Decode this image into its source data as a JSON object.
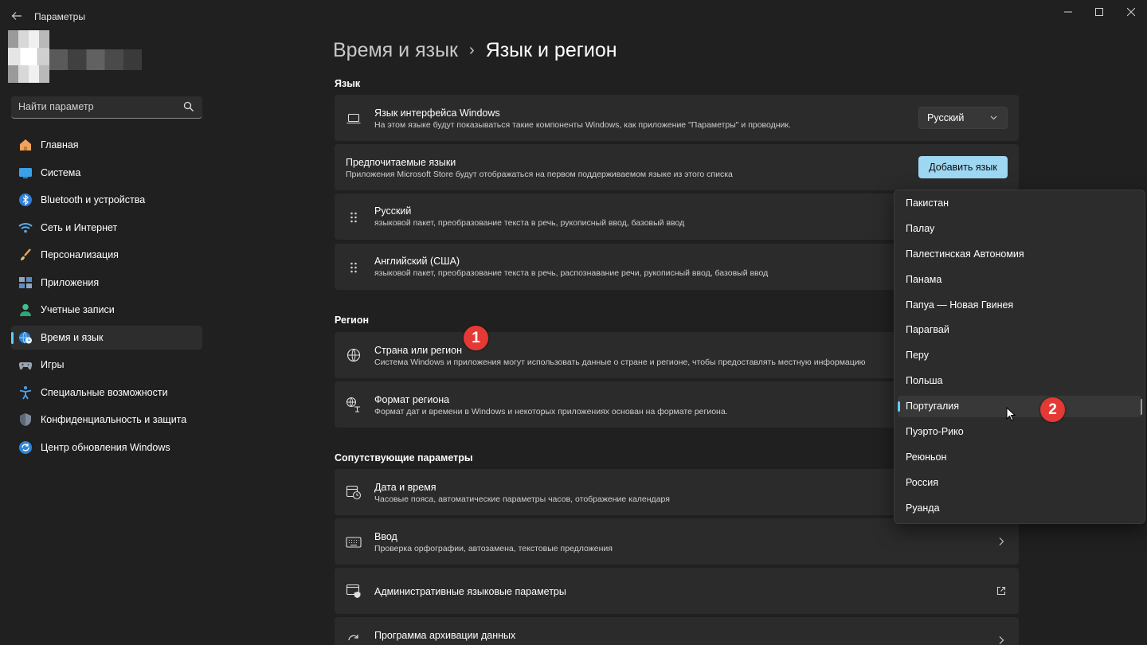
{
  "window": {
    "title": "Параметры"
  },
  "search": {
    "placeholder": "Найти параметр"
  },
  "sidebar": {
    "items": [
      {
        "label": "Главная",
        "icon": "home-icon"
      },
      {
        "label": "Система",
        "icon": "system-icon"
      },
      {
        "label": "Bluetooth и устройства",
        "icon": "bluetooth-icon"
      },
      {
        "label": "Сеть и Интернет",
        "icon": "wifi-icon"
      },
      {
        "label": "Персонализация",
        "icon": "brush-icon"
      },
      {
        "label": "Приложения",
        "icon": "apps-icon"
      },
      {
        "label": "Учетные записи",
        "icon": "person-icon"
      },
      {
        "label": "Время и язык",
        "icon": "globe-clock-icon",
        "active": true
      },
      {
        "label": "Игры",
        "icon": "gamepad-icon"
      },
      {
        "label": "Специальные возможности",
        "icon": "accessibility-icon"
      },
      {
        "label": "Конфиденциальность и защита",
        "icon": "shield-icon"
      },
      {
        "label": "Центр обновления Windows",
        "icon": "update-icon"
      }
    ]
  },
  "breadcrumb": {
    "parent": "Время и язык",
    "separator": "›",
    "current": "Язык и регион"
  },
  "sections": {
    "language": "Язык",
    "region": "Регион",
    "related": "Сопутствующие параметры"
  },
  "language_cards": {
    "display_language": {
      "title": "Язык интерфейса Windows",
      "desc": "На этом языке будут показываться такие компоненты Windows, как приложение \"Параметры\" и проводник.",
      "value": "Русский"
    },
    "preferred": {
      "title": "Предпочитаемые языки",
      "desc": "Приложения Microsoft Store будут отображаться на первом поддерживаемом языке из этого списка",
      "button": "Добавить язык"
    },
    "languages": [
      {
        "title": "Русский",
        "desc": "языковой пакет, преобразование текста в речь, рукописный ввод, базовый ввод"
      },
      {
        "title": "Английский (США)",
        "desc": "языковой пакет, преобразование текста в речь, распознавание речи, рукописный ввод, базовый ввод"
      }
    ]
  },
  "region_cards": {
    "country": {
      "title": "Страна или регион",
      "desc": "Система Windows и приложения могут использовать данные о стране и регионе, чтобы предоставлять местную информацию"
    },
    "format": {
      "title": "Формат региона",
      "desc": "Формат дат и времени в Windows и некоторых приложениях основан на формате региона."
    }
  },
  "related_cards": [
    {
      "title": "Дата и время",
      "desc": "Часовые пояса, автоматические параметры часов, отображение календаря",
      "icon": "calendar-clock-icon",
      "action": "chevron"
    },
    {
      "title": "Ввод",
      "desc": "Проверка орфографии, автозамена, текстовые предложения",
      "icon": "keyboard-icon",
      "action": "chevron"
    },
    {
      "title": "Административные языковые параметры",
      "desc": "",
      "icon": "admin-language-icon",
      "action": "external"
    },
    {
      "title": "Программа архивации данных",
      "desc": "",
      "icon": "backup-icon",
      "action": "chevron"
    }
  ],
  "country_dropdown": {
    "options": [
      "Пакистан",
      "Палау",
      "Палестинская Автономия",
      "Панама",
      "Папуа — Новая Гвинея",
      "Парагвай",
      "Перу",
      "Польша",
      "Португалия",
      "Пуэрто-Рико",
      "Реюньон",
      "Россия",
      "Руанда"
    ],
    "selected": "Португалия"
  },
  "annotations": {
    "marker1": "1",
    "marker2": "2",
    "color": "#e53935"
  },
  "colors": {
    "accent": "#60cdff",
    "accent_button": "#9ed7f2",
    "background": "#202020",
    "card": "#2b2b2b"
  }
}
